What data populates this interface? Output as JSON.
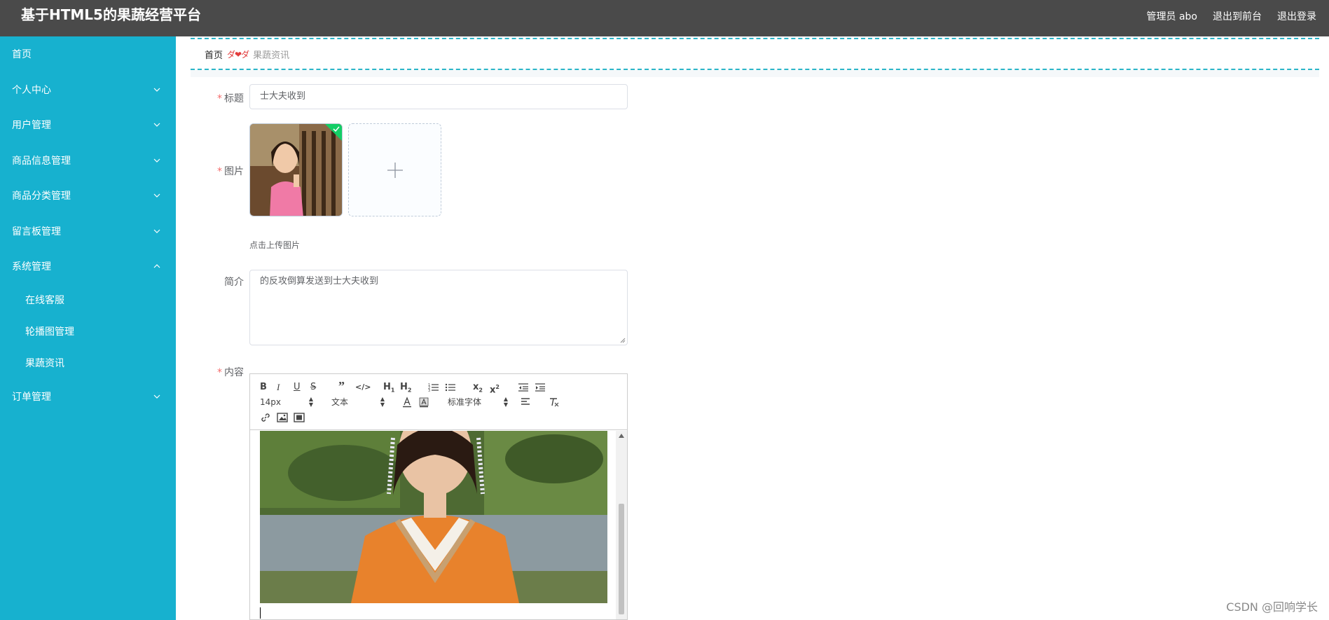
{
  "app": {
    "title": "基于HTML5的果蔬经营平台"
  },
  "topbar": {
    "user": "管理员 abo",
    "front_link": "退出到前台",
    "logout_link": "退出登录"
  },
  "sidebar": {
    "items": [
      {
        "label": "首页",
        "expandable": false
      },
      {
        "label": "个人中心",
        "expandable": true
      },
      {
        "label": "用户管理",
        "expandable": true
      },
      {
        "label": "商品信息管理",
        "expandable": true
      },
      {
        "label": "商品分类管理",
        "expandable": true
      },
      {
        "label": "留言板管理",
        "expandable": true
      },
      {
        "label": "系统管理",
        "expandable": true,
        "expanded": true
      },
      {
        "label": "订单管理",
        "expandable": true
      }
    ],
    "subitems": [
      "在线客服",
      "轮播图管理",
      "果蔬资讯"
    ]
  },
  "breadcrumb": {
    "home": "首页",
    "separator": "ダ❤ダ",
    "current": "果蔬资讯"
  },
  "form": {
    "title_label": "标题",
    "title_value": "士大夫收到",
    "image_label": "图片",
    "upload_hint": "点击上传图片",
    "summary_label": "简介",
    "summary_value": "的反攻倒算发送到士大夫收到",
    "content_label": "内容"
  },
  "editor": {
    "font_size": "14px",
    "header_select": "文本",
    "font_family": "标准字体",
    "buttons": [
      "bold",
      "italic",
      "underline",
      "strike",
      "blockquote",
      "code-block",
      "header-1",
      "header-2",
      "ordered-list",
      "bullet-list",
      "subscript",
      "superscript",
      "indent-decrease",
      "indent-increase",
      "text-color",
      "background-color",
      "align",
      "clean",
      "link",
      "image",
      "video"
    ]
  },
  "watermark": "CSDN @回响学长",
  "colors": {
    "topbar": "#4a4a4a",
    "sidebar": "#17b1cf",
    "accent_border": "#2bb5c8",
    "required": "#f56c6c"
  }
}
